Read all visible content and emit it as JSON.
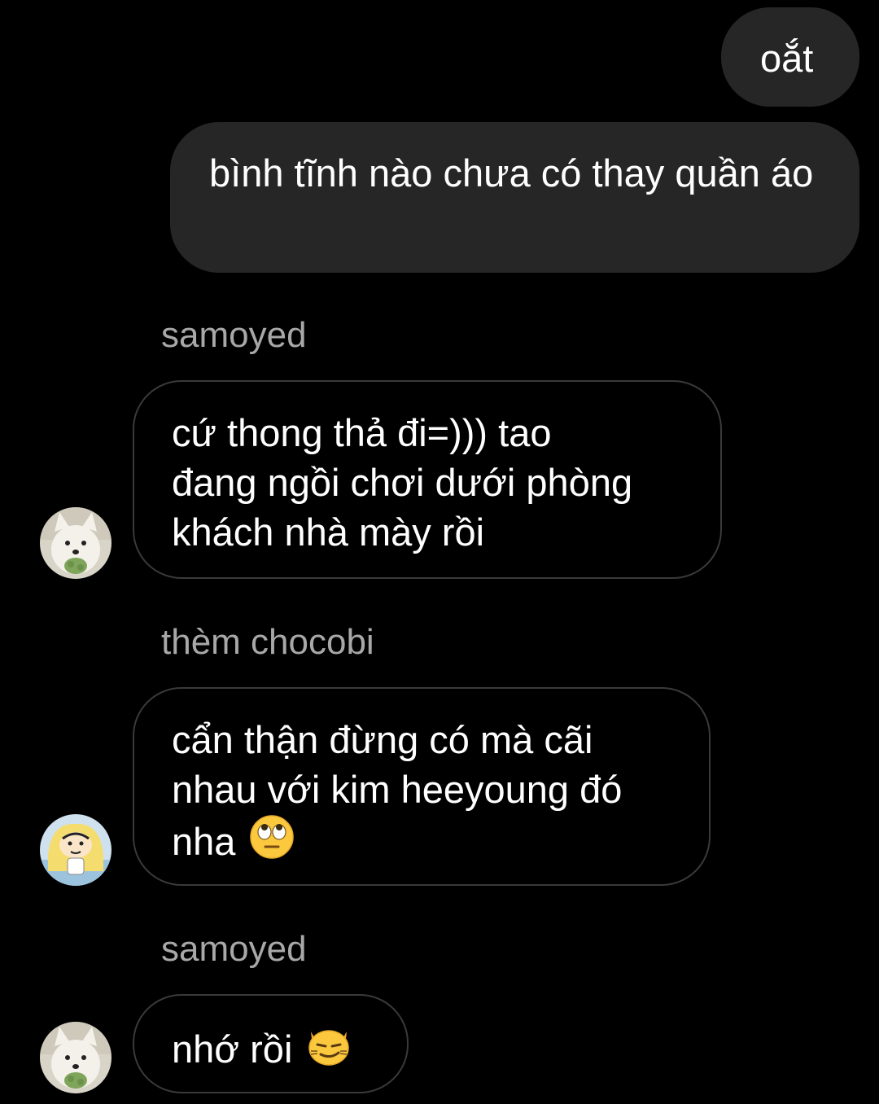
{
  "messages": [
    {
      "type": "sent",
      "text": "oắt"
    },
    {
      "type": "sent",
      "text": "bình tĩnh nào chưa có thay quần áo"
    },
    {
      "type": "received",
      "sender": "samoyed",
      "lines": [
        "cứ thong thả đi=))) tao",
        "đang ngồi chơi dưới phòng",
        "khách nhà mày rồi"
      ]
    },
    {
      "type": "received",
      "sender": "thèm chocobi",
      "lines": [
        "cẩn thận đừng có mà cãi",
        "nhau với kim heeyoung đó",
        "nha"
      ],
      "emoji": "face-with-rolling-eyes-emoji"
    },
    {
      "type": "received",
      "sender": "samoyed",
      "lines": [
        "nhớ rồi"
      ],
      "emoji": "smirking-cat-emoji"
    }
  ],
  "colors": {
    "background": "#000000",
    "sent_bubble": "#262626",
    "received_border": "#3a3a3a",
    "sender_name": "#a8a8a8"
  }
}
